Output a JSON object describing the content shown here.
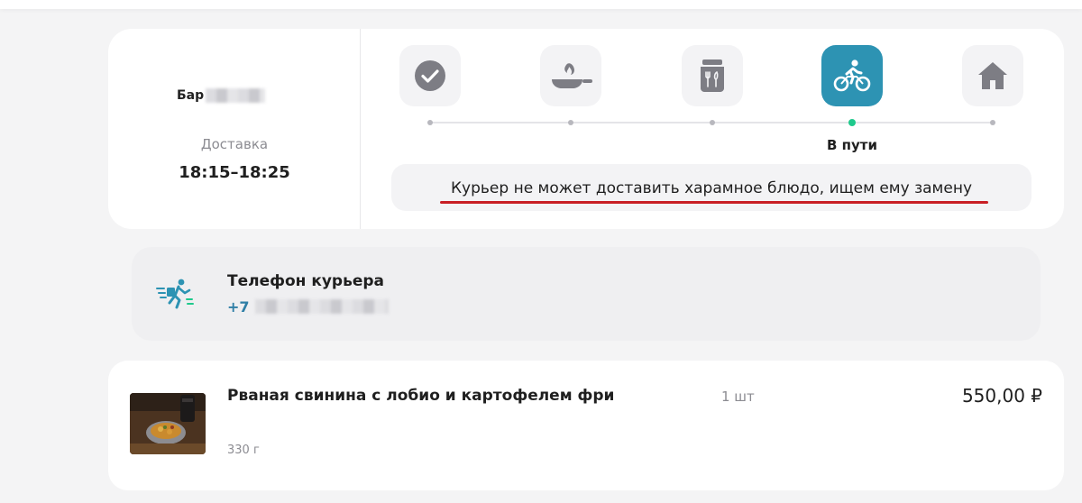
{
  "order": {
    "restaurant_name": "Бар",
    "delivery_label": "Доставка",
    "delivery_time": "18:15–18:25"
  },
  "progress": {
    "steps": [
      {
        "icon": "check-circle-icon",
        "status": "done"
      },
      {
        "icon": "cooking-pan-icon",
        "status": "done"
      },
      {
        "icon": "packaged-food-icon",
        "status": "done"
      },
      {
        "icon": "bicycle-courier-icon",
        "status": "current"
      },
      {
        "icon": "home-icon",
        "status": "pending"
      }
    ],
    "current_step_label": "В пути",
    "notice": "Курьер не может доставить харамное блюдо, ищем ему замену",
    "accent_color": "#2d93b3",
    "dot_active_color": "#1fc98c",
    "underline_color": "#c81e24"
  },
  "courier": {
    "title": "Телефон курьера",
    "phone_prefix": "+7",
    "icon": "running-courier-icon"
  },
  "items": [
    {
      "name": "Рваная свинина с лобио и картофелем фри",
      "weight": "330 г",
      "quantity": "1 шт",
      "price": "550,00 ₽"
    }
  ]
}
